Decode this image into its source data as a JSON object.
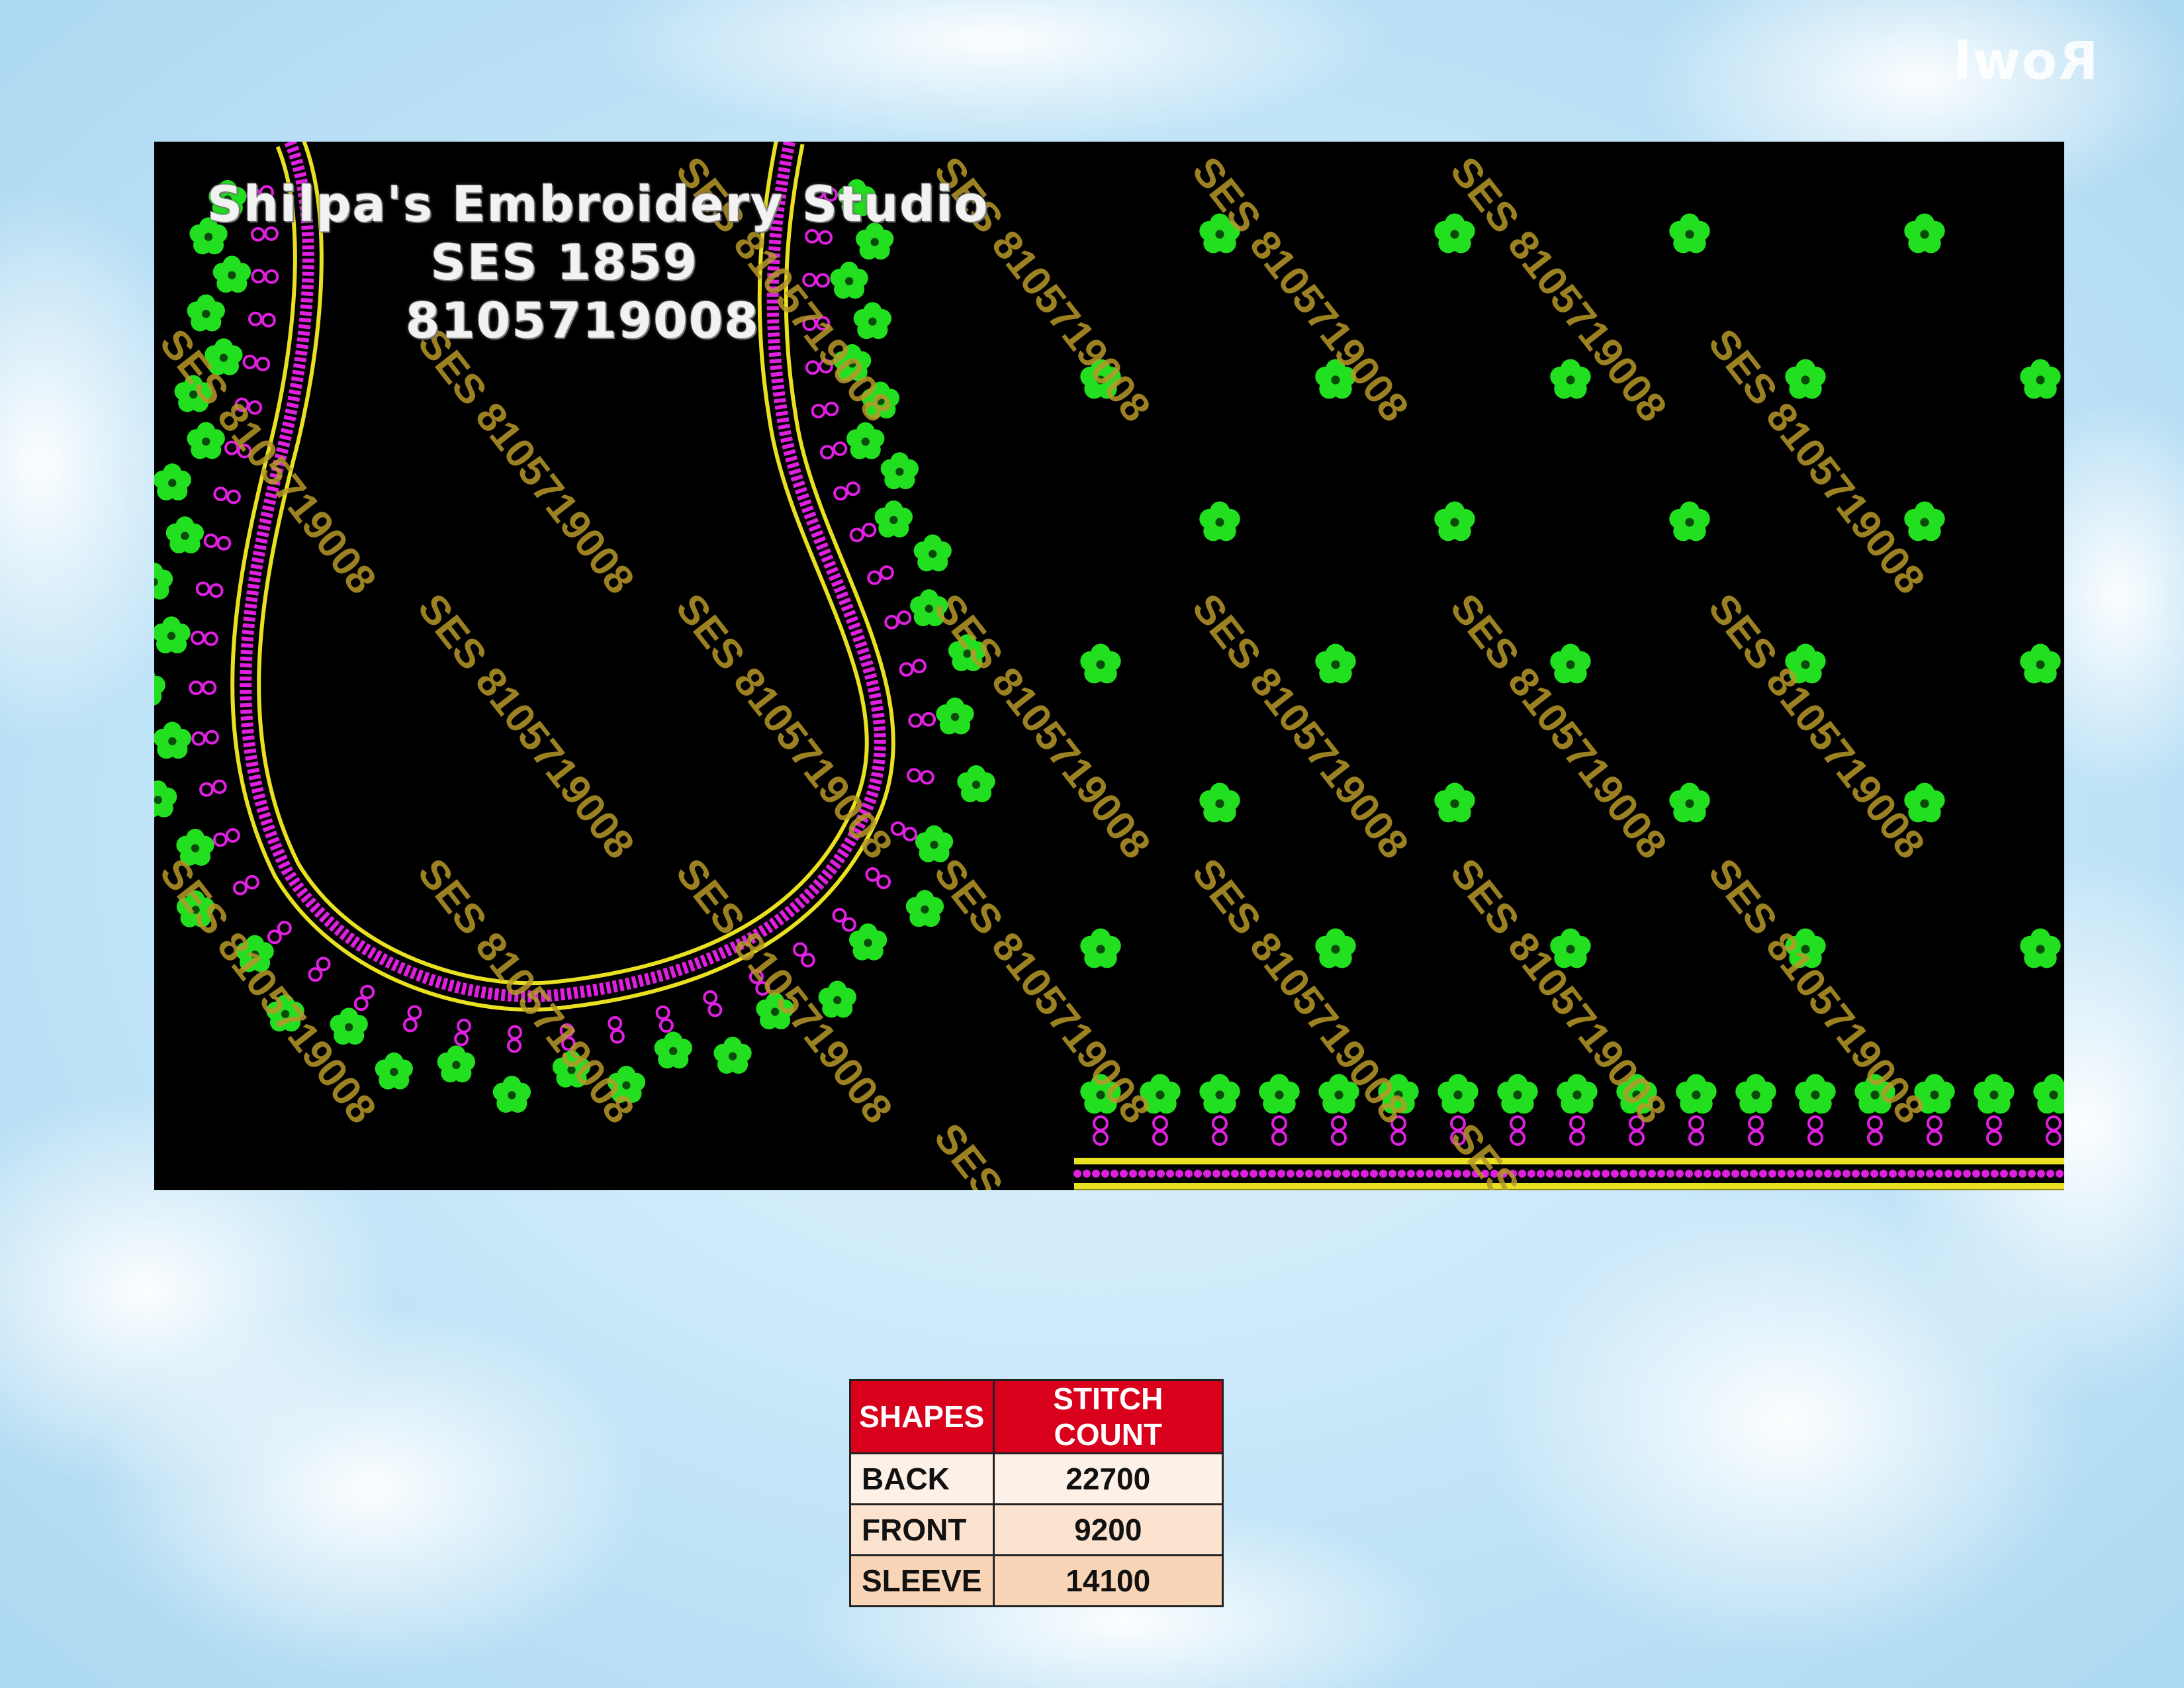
{
  "colors": {
    "canvas": "#000000",
    "flower": "#22e020",
    "bead": "#e020e0",
    "gold": "#e8e020",
    "watermark": "#b8982a",
    "table_header": "#d9001c"
  },
  "studio": {
    "name": "Shilpa's Embroidery Studio",
    "code": "SES 1859",
    "phone": "8105719008"
  },
  "watermark_text": "SES 8105719008",
  "logo_text": "Rowl",
  "table": {
    "headers": [
      "SHAPES",
      "STITCH COUNT"
    ],
    "rows": [
      {
        "shape": "BACK",
        "count": "22700"
      },
      {
        "shape": "FRONT",
        "count": "9200"
      },
      {
        "shape": "SLEEVE",
        "count": "14100"
      }
    ]
  }
}
